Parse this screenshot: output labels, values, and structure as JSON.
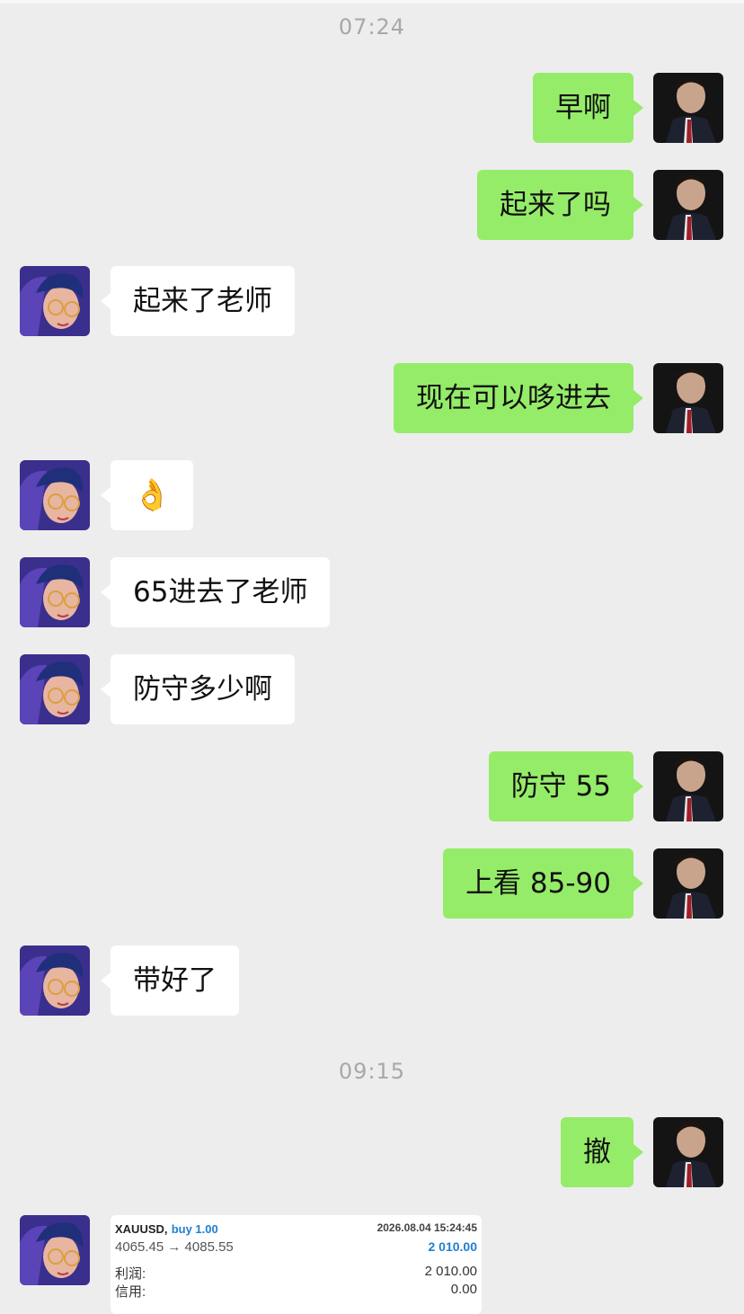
{
  "timestamps": [
    "07:24",
    "09:15"
  ],
  "messages": [
    {
      "side": "out",
      "text": "早啊"
    },
    {
      "side": "out",
      "text": "起来了吗"
    },
    {
      "side": "in",
      "text": "起来了老师"
    },
    {
      "side": "out",
      "text": "现在可以哆进去"
    },
    {
      "side": "in",
      "text": "👌"
    },
    {
      "side": "in",
      "text": "65进去了老师"
    },
    {
      "side": "in",
      "text": "防守多少啊"
    },
    {
      "side": "out",
      "text": "防守 55"
    },
    {
      "side": "out",
      "text": "上看 85-90"
    },
    {
      "side": "in",
      "text": "带好了"
    },
    {
      "side": "out",
      "text": "撤"
    }
  ],
  "trade": {
    "symbol": "XAUUSD,",
    "action": "buy 1.00",
    "datetime": "2026.08.04 15:24:45",
    "prices": "4065.45 → 4085.55",
    "profit_value": "2 010.00",
    "profit_label": "利润:",
    "profit_amount": "2 010.00",
    "credit_label": "信用:",
    "credit_amount": "0.00"
  },
  "colors": {
    "outgoing_bubble": "#95ec69",
    "incoming_bubble": "#ffffff",
    "background": "#ededed",
    "profit_blue": "#1f7fd0"
  }
}
